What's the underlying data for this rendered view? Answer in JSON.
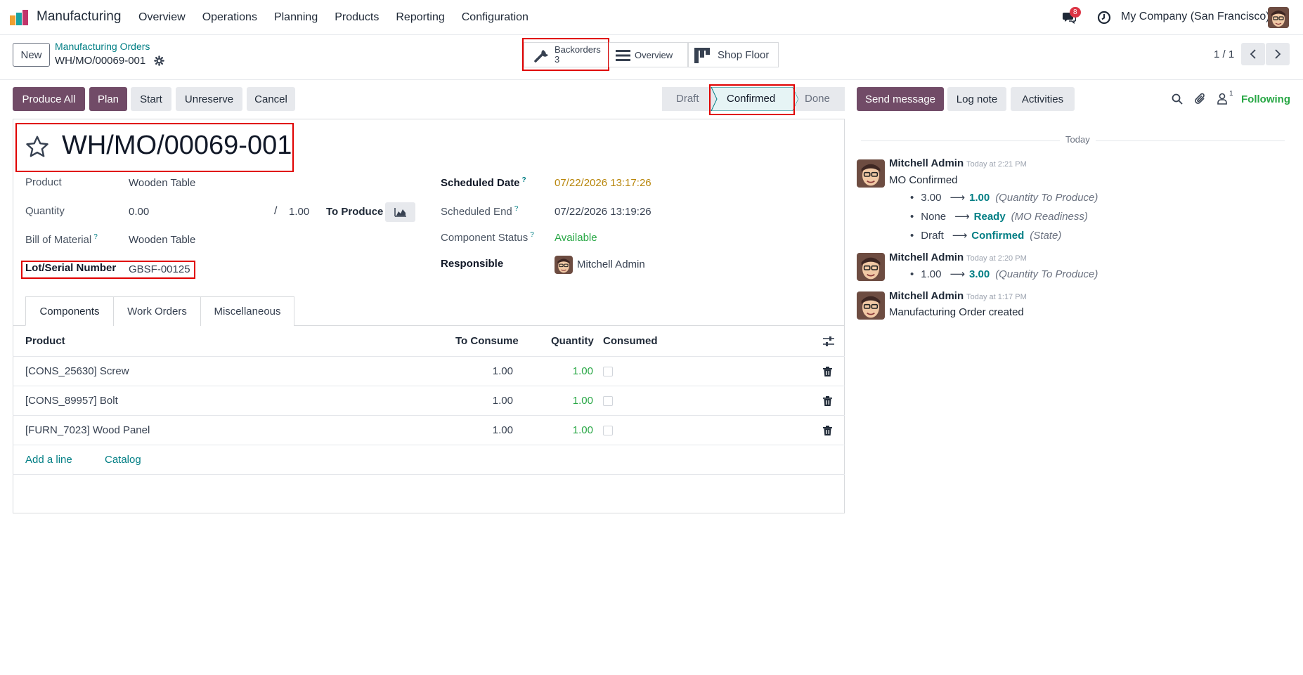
{
  "navbar": {
    "app_name": "Manufacturing",
    "menu": [
      "Overview",
      "Operations",
      "Planning",
      "Products",
      "Reporting",
      "Configuration"
    ],
    "messages_count": "8",
    "company": "My Company (San Francisco)"
  },
  "control": {
    "new_label": "New",
    "breadcrumb_parent": "Manufacturing Orders",
    "record_name": "WH/MO/00069-001",
    "backorders_label": "Backorders",
    "backorders_count": "3",
    "overview_label": "Overview",
    "shopfloor_label": "Shop Floor",
    "pager": "1 / 1"
  },
  "statusbar_buttons": {
    "produce_all": "Produce All",
    "plan": "Plan",
    "start": "Start",
    "unreserve": "Unreserve",
    "cancel": "Cancel"
  },
  "stages": [
    "Draft",
    "Confirmed",
    "Done"
  ],
  "form": {
    "title": "WH/MO/00069-001",
    "product_label": "Product",
    "product_value": "Wooden Table",
    "quantity_label": "Quantity",
    "quantity_value": "0.00",
    "quantity_sep": "/",
    "quantity_target": "1.00",
    "to_produce_label": "To Produce",
    "bom_label": "Bill of Material",
    "bom_value": "Wooden Table",
    "lot_label": "Lot/Serial Number",
    "lot_value": "GBSF-00125",
    "scheduled_date_label": "Scheduled Date",
    "scheduled_date_value": "07/22/2026 13:17:26",
    "scheduled_end_label": "Scheduled End",
    "scheduled_end_value": "07/22/2026 13:19:26",
    "component_status_label": "Component Status",
    "component_status_value": "Available",
    "responsible_label": "Responsible",
    "responsible_value": "Mitchell Admin",
    "help_mark": "?"
  },
  "tabs": [
    "Components",
    "Work Orders",
    "Miscellaneous"
  ],
  "components": {
    "headers": {
      "product": "Product",
      "to_consume": "To Consume",
      "quantity": "Quantity",
      "consumed": "Consumed"
    },
    "rows": [
      {
        "product": "[CONS_25630] Screw",
        "to_consume": "1.00",
        "quantity": "1.00"
      },
      {
        "product": "[CONS_89957] Bolt",
        "to_consume": "1.00",
        "quantity": "1.00"
      },
      {
        "product": "[FURN_7023] Wood Panel",
        "to_consume": "1.00",
        "quantity": "1.00"
      }
    ],
    "add_line": "Add a line",
    "catalog": "Catalog"
  },
  "chatter": {
    "send_message": "Send message",
    "log_note": "Log note",
    "activities": "Activities",
    "followers_count": "1",
    "following": "Following",
    "date_separator": "Today",
    "messages": [
      {
        "author": "Mitchell Admin",
        "time": "Today at 2:21 PM",
        "body": "MO Confirmed",
        "changes": [
          {
            "old": "3.00",
            "new": "1.00",
            "field": "(Quantity To Produce)"
          },
          {
            "old": "None",
            "new": "Ready",
            "field": "(MO Readiness)"
          },
          {
            "old": "Draft",
            "new": "Confirmed",
            "field": "(State)"
          }
        ]
      },
      {
        "author": "Mitchell Admin",
        "time": "Today at 2:20 PM",
        "body": "",
        "changes": [
          {
            "old": "1.00",
            "new": "3.00",
            "field": "(Quantity To Produce)"
          }
        ]
      },
      {
        "author": "Mitchell Admin",
        "time": "Today at 1:17 PM",
        "body": "Manufacturing Order created",
        "changes": []
      }
    ]
  },
  "colors": {
    "primary": "#714b67",
    "link": "#017e84",
    "success": "#28a745",
    "warning": "#b8860b",
    "highlight_box": "#e00000"
  }
}
